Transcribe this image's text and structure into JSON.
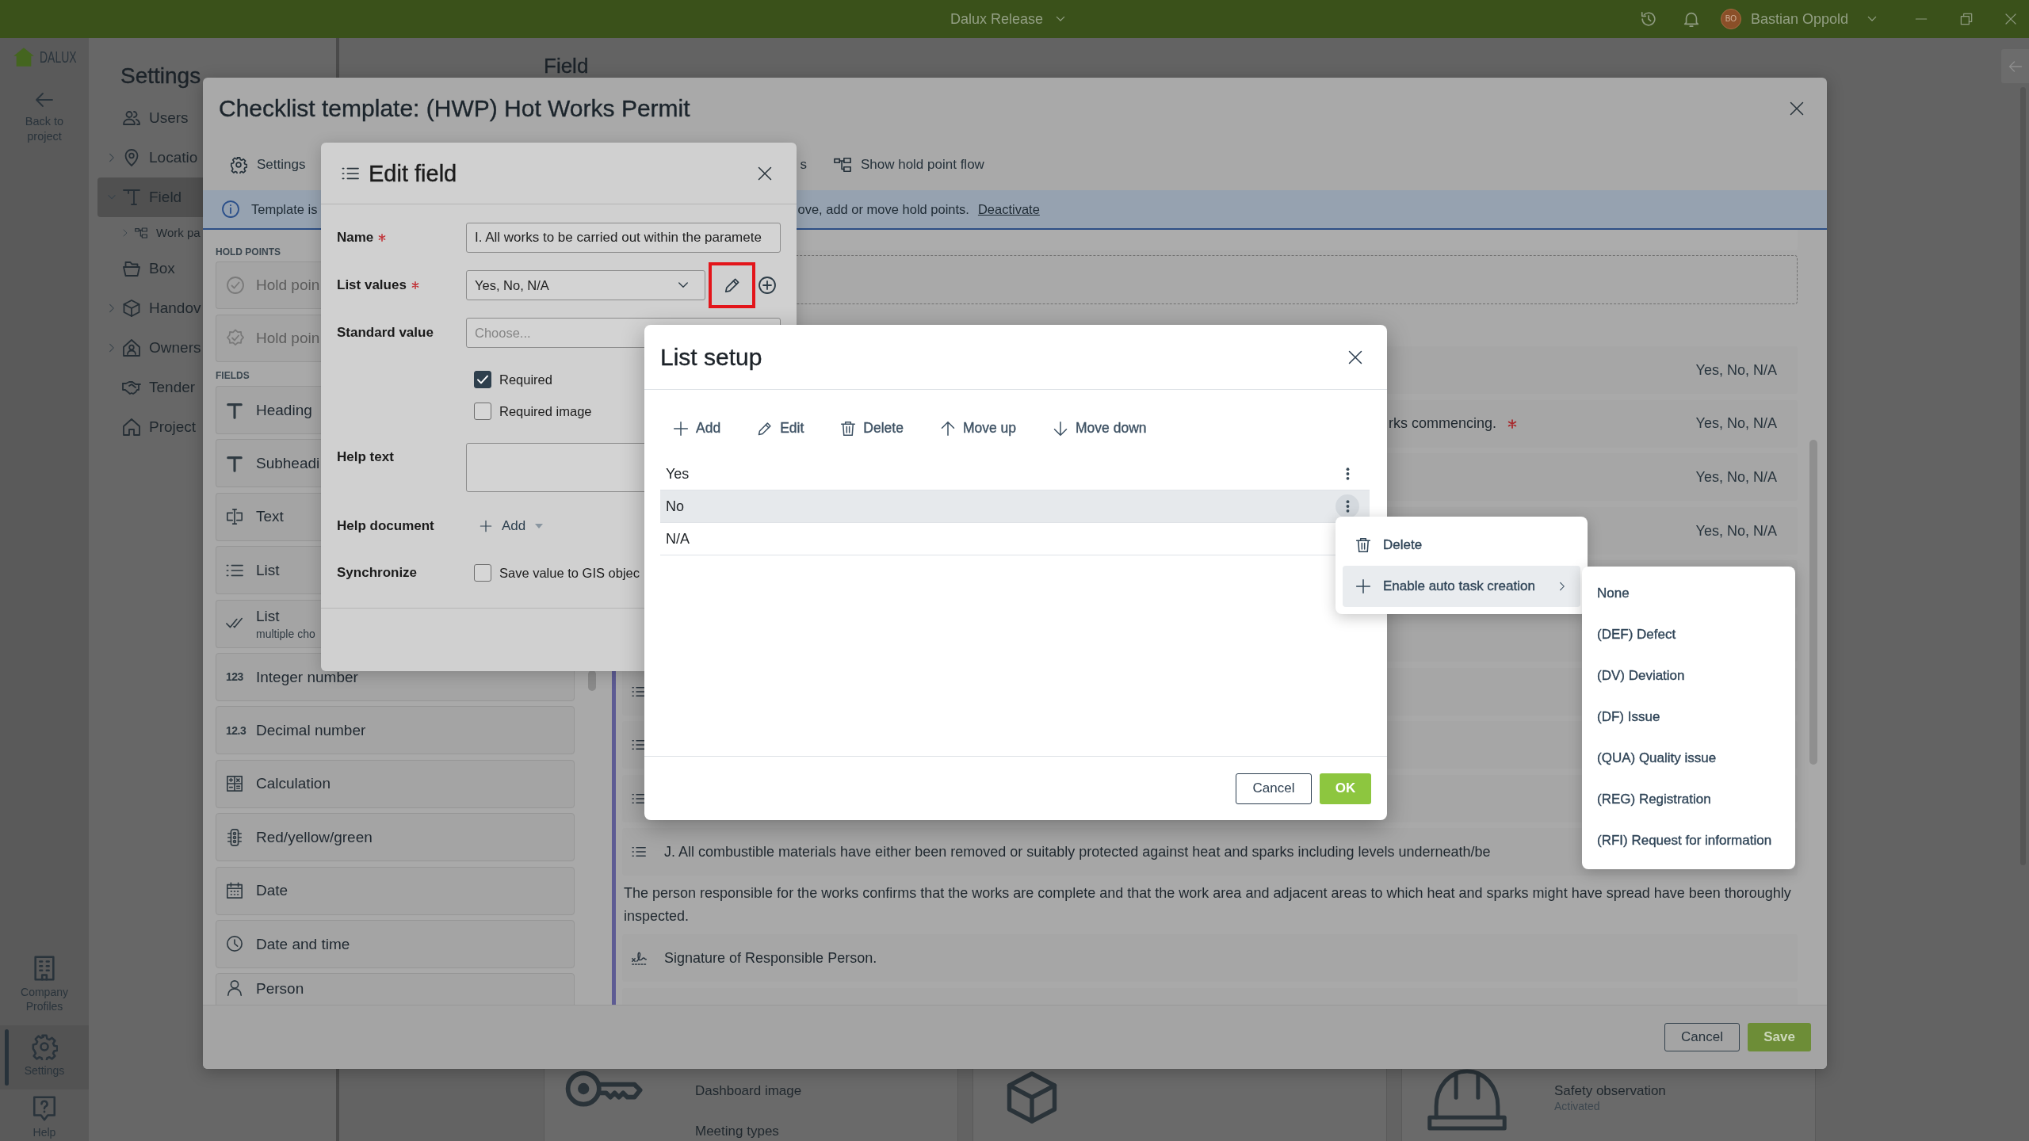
{
  "title_bar": {
    "project": "Dalux Release",
    "user_initials": "BO",
    "user_name": "Bastian Oppold"
  },
  "rail": {
    "logo": "DALUX",
    "back": "Back to project",
    "items": [
      {
        "label": "Company Profiles",
        "selected": false
      },
      {
        "label": "Settings",
        "selected": true
      },
      {
        "label": "Help",
        "selected": false
      }
    ]
  },
  "settings_panel": {
    "title": "Settings",
    "items": [
      {
        "label": "Users",
        "kind": "page",
        "selected": false
      },
      {
        "label": "Locatio",
        "kind": "folder",
        "expanded": false,
        "selected": false
      },
      {
        "label": "Field",
        "kind": "folder",
        "expanded": true,
        "selected": true,
        "children": [
          {
            "label": "Work pa",
            "kind": "folder",
            "expanded": false,
            "selected": false
          }
        ]
      },
      {
        "label": "Box",
        "kind": "page",
        "selected": false
      },
      {
        "label": "Handov",
        "kind": "folder",
        "expanded": false,
        "selected": false
      },
      {
        "label": "Owners",
        "kind": "folder",
        "expanded": false,
        "selected": false
      },
      {
        "label": "Tender",
        "kind": "page",
        "selected": false
      },
      {
        "label": "Project",
        "kind": "page",
        "selected": false
      }
    ]
  },
  "page": {
    "title": "Field",
    "cards": [
      {
        "kind": "links",
        "links": [
          "Dashboard image",
          "Meeting types"
        ]
      },
      {
        "kind": "icon"
      },
      {
        "kind": "status",
        "title": "Safety observation",
        "status": "Activated"
      }
    ]
  },
  "checklist_dialog": {
    "title": "Checklist template: (HWP) Hot Works Permit",
    "toolbar": [
      "Settings",
      "s",
      "Show hold point flow"
    ],
    "banner": {
      "text_start": "Template is",
      "text_end": "ove, add or move hold points.",
      "link": "Deactivate"
    },
    "hold_points": {
      "heading": "HOLD POINTS",
      "items": [
        {
          "label": "Hold poin",
          "disabled": true
        },
        {
          "label": "Hold poin",
          "disabled": true
        }
      ]
    },
    "field_types": {
      "heading": "FIELDS",
      "items": [
        {
          "label": "Heading"
        },
        {
          "label": "Subheadi"
        },
        {
          "label": "Text"
        },
        {
          "label": "List"
        },
        {
          "label": "List",
          "note": "multiple cho"
        },
        {
          "label": "Integer number",
          "icon_text": "123"
        },
        {
          "label": "Decimal number",
          "icon_text": "12.3"
        },
        {
          "label": "Calculation"
        },
        {
          "label": "Red/yellow/green"
        },
        {
          "label": "Date"
        },
        {
          "label": "Date and time"
        },
        {
          "label": "Person"
        }
      ]
    },
    "rows": [
      {
        "kind": "field",
        "value": "Yes, No, N/A"
      },
      {
        "kind": "field",
        "text": "rks commencing.",
        "required": true,
        "value": "Yes, No, N/A"
      },
      {
        "kind": "field",
        "value": "Yes, No, N/A"
      },
      {
        "kind": "field",
        "value": "Yes, No, N/A"
      },
      {
        "kind": "field"
      },
      {
        "kind": "field"
      },
      {
        "kind": "list"
      },
      {
        "kind": "list"
      },
      {
        "kind": "list"
      },
      {
        "kind": "list",
        "text": "J. All combustible materials have either been removed or suitably protected against heat and sparks including levels underneath/be"
      },
      {
        "kind": "note",
        "text": "The person responsible for the works confirms that the works are complete and that the work area and adjacent areas to which heat and sparks might have spread have been thoroughly inspected."
      },
      {
        "kind": "signature",
        "text": "Signature of Responsible Person."
      },
      {
        "kind": "field"
      }
    ],
    "buttons": [
      {
        "label": "Cancel",
        "kind": "secondary"
      },
      {
        "label": "Save",
        "kind": "primary"
      }
    ]
  },
  "edit_field_dialog": {
    "title": "Edit field",
    "name": {
      "label": "Name",
      "required": true,
      "value": "I. All works to be carried out within the paramete"
    },
    "list_values": {
      "label": "List values",
      "required": true,
      "value": "Yes, No, N/A",
      "edit_highlighted": true
    },
    "standard_value": {
      "label": "Standard value",
      "required": false,
      "placeholder": "Choose..."
    },
    "options": [
      {
        "label": "Required",
        "checked": true
      },
      {
        "label": "Required image",
        "checked": false
      }
    ],
    "help_text": {
      "label": "Help text",
      "required": false
    },
    "help_document": {
      "label": "Help document",
      "required": false,
      "button": "Add"
    },
    "synchronize": {
      "label": "Synchronize",
      "required": false,
      "option": {
        "label": "Save value to GIS objec",
        "checked": false
      }
    }
  },
  "list_setup_dialog": {
    "title": "List setup",
    "toolbar": [
      "Add",
      "Edit",
      "Delete",
      "Move up",
      "Move down"
    ],
    "items": [
      {
        "label": "Yes",
        "selected": false
      },
      {
        "label": "No",
        "selected": true
      },
      {
        "label": "N/A",
        "selected": false
      }
    ],
    "buttons": [
      {
        "label": "Cancel",
        "kind": "secondary"
      },
      {
        "label": "OK",
        "kind": "primary"
      }
    ]
  },
  "row_menu": {
    "items": [
      {
        "label": "Delete",
        "kind": "action",
        "selected": false
      },
      {
        "label": "Enable auto task creation",
        "kind": "submenu",
        "selected": true
      }
    ]
  },
  "task_type_menu": {
    "items": [
      "None",
      "(DEF) Defect",
      "(DV) Deviation",
      "(DF) Issue",
      "(QUA) Quality issue",
      "(REG) Registration",
      "(RFI) Request for information"
    ]
  }
}
